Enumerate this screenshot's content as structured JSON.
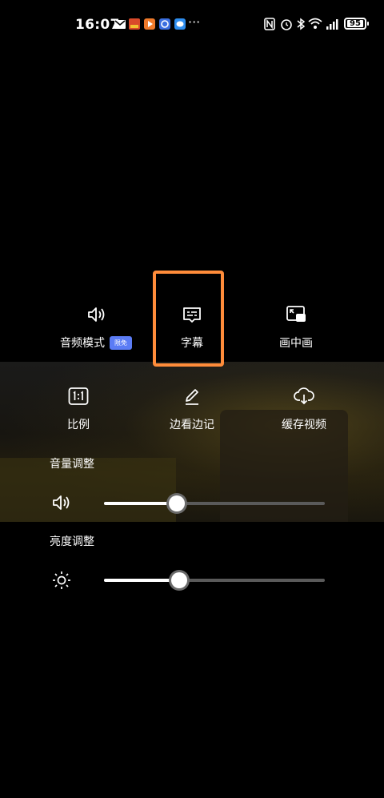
{
  "status_bar": {
    "time": "16:07",
    "notif_icons": [
      "mail-icon",
      "app-notif-icon",
      "video-app-icon",
      "browser-icon",
      "chat-icon"
    ],
    "more": "···",
    "battery": "95"
  },
  "menu": {
    "row1": [
      {
        "label": "音频模式",
        "badge": "限免",
        "icon": "speaker-icon"
      },
      {
        "label": "字幕",
        "icon": "subtitles-icon"
      },
      {
        "label": "画中画",
        "icon": "picture-in-picture-icon"
      }
    ],
    "row2": [
      {
        "label": "比例",
        "icon": "aspect-ratio-icon"
      },
      {
        "label": "边看边记",
        "icon": "pencil-icon"
      },
      {
        "label": "缓存视频",
        "icon": "cloud-download-icon"
      }
    ]
  },
  "volume": {
    "title": "音量调整",
    "value_fraction": 0.33
  },
  "brightness": {
    "title": "亮度调整",
    "value_fraction": 0.34
  },
  "colors": {
    "accent_highlight": "#ff8c3a",
    "badge": "#5b7cf5"
  }
}
